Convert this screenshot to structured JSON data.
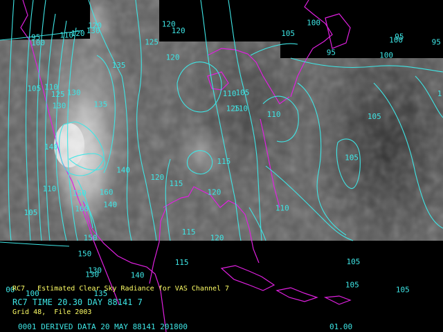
{
  "colors": {
    "contour": "#3ee6e6",
    "coast": "#e020e0",
    "caption_yellow": "#ffff66",
    "caption_cyan": "#3ee6e6",
    "background": "#000000"
  },
  "contour_labels": [
    {
      "text": "95",
      "lon": -126.5,
      "lat": 52.5
    },
    {
      "text": "100",
      "lon": -126.5,
      "lat": 51.7
    },
    {
      "text": "110",
      "lon": -121.5,
      "lat": 52.8
    },
    {
      "text": "120",
      "lon": -119.5,
      "lat": 53.0
    },
    {
      "text": "120",
      "lon": -116.5,
      "lat": 54.1
    },
    {
      "text": "130",
      "lon": -116.8,
      "lat": 53.4
    },
    {
      "text": "120",
      "lon": -103.5,
      "lat": 54.3
    },
    {
      "text": "120",
      "lon": -101.8,
      "lat": 53.4
    },
    {
      "text": "125",
      "lon": -106.5,
      "lat": 51.8
    },
    {
      "text": "135",
      "lon": -112.3,
      "lat": 48.6
    },
    {
      "text": "120",
      "lon": -102.8,
      "lat": 49.7
    },
    {
      "text": "105",
      "lon": -127.2,
      "lat": 45.4
    },
    {
      "text": "110",
      "lon": -124.2,
      "lat": 45.6
    },
    {
      "text": "125",
      "lon": -123.0,
      "lat": 44.6
    },
    {
      "text": "130",
      "lon": -120.2,
      "lat": 44.8
    },
    {
      "text": "130",
      "lon": -122.8,
      "lat": 43.0
    },
    {
      "text": "135",
      "lon": -115.5,
      "lat": 43.2
    },
    {
      "text": "140",
      "lon": -124.2,
      "lat": 37.3
    },
    {
      "text": "140",
      "lon": -111.5,
      "lat": 34.1
    },
    {
      "text": "110",
      "lon": -124.5,
      "lat": 31.5
    },
    {
      "text": "105",
      "lon": -127.8,
      "lat": 28.2
    },
    {
      "text": "150",
      "lon": -119.2,
      "lat": 30.9
    },
    {
      "text": "160",
      "lon": -114.5,
      "lat": 31.0
    },
    {
      "text": "140",
      "lon": -113.8,
      "lat": 29.3
    },
    {
      "text": "120",
      "lon": -105.5,
      "lat": 33.1
    },
    {
      "text": "115",
      "lon": -102.2,
      "lat": 32.2
    },
    {
      "text": "160",
      "lon": -118.8,
      "lat": 28.7
    },
    {
      "text": "150",
      "lon": -117.3,
      "lat": 24.7
    },
    {
      "text": "150",
      "lon": -118.3,
      "lat": 22.5
    },
    {
      "text": "130",
      "lon": -116.5,
      "lat": 20.2
    },
    {
      "text": "130",
      "lon": -117.0,
      "lat": 19.6
    },
    {
      "text": "140",
      "lon": -109.0,
      "lat": 19.5
    },
    {
      "text": "135",
      "lon": -115.5,
      "lat": 17.0
    },
    {
      "text": "00",
      "lon": -131.0,
      "lat": 17.5
    },
    {
      "text": "100",
      "lon": -127.5,
      "lat": 17.0
    },
    {
      "text": "105",
      "lon": -82.5,
      "lat": 53.0
    },
    {
      "text": "95",
      "lon": -74.5,
      "lat": 50.4
    },
    {
      "text": "100",
      "lon": -78.0,
      "lat": 54.5
    },
    {
      "text": "100",
      "lon": -63.5,
      "lat": 52.1
    },
    {
      "text": "100",
      "lon": -65.2,
      "lat": 50.0
    },
    {
      "text": "95",
      "lon": -62.5,
      "lat": 52.6
    },
    {
      "text": "95",
      "lon": -56.0,
      "lat": 51.8
    },
    {
      "text": "1",
      "lon": -55.0,
      "lat": 44.7
    },
    {
      "text": "110",
      "lon": -92.8,
      "lat": 44.7
    },
    {
      "text": "110",
      "lon": -90.8,
      "lat": 42.6
    },
    {
      "text": "105",
      "lon": -90.5,
      "lat": 44.8
    },
    {
      "text": "125",
      "lon": -92.2,
      "lat": 42.6
    },
    {
      "text": "110",
      "lon": -85.0,
      "lat": 41.8
    },
    {
      "text": "115",
      "lon": -93.8,
      "lat": 35.3
    },
    {
      "text": "120",
      "lon": -95.5,
      "lat": 31.0
    },
    {
      "text": "115",
      "lon": -100.0,
      "lat": 25.5
    },
    {
      "text": "120",
      "lon": -95.0,
      "lat": 24.7
    },
    {
      "text": "115",
      "lon": -101.2,
      "lat": 21.3
    },
    {
      "text": "110",
      "lon": -83.5,
      "lat": 28.8
    },
    {
      "text": "105",
      "lon": -67.3,
      "lat": 41.5
    },
    {
      "text": "105",
      "lon": -71.3,
      "lat": 35.8
    },
    {
      "text": "105",
      "lon": -71.0,
      "lat": 21.4
    },
    {
      "text": "105",
      "lon": -71.2,
      "lat": 18.2
    },
    {
      "text": "105",
      "lon": -62.3,
      "lat": 17.5
    }
  ],
  "captions": {
    "line1": "RC7   Estimated Clear Sky Radiance for VAS Channel 7",
    "line2": "RC7 TIME 20.30 DAY 88141 7",
    "line3": "Grid 48,  File 2003"
  },
  "footer": {
    "left": "0001 DERIVED DATA 20 MAY 88141 201800",
    "right": "01.00"
  }
}
